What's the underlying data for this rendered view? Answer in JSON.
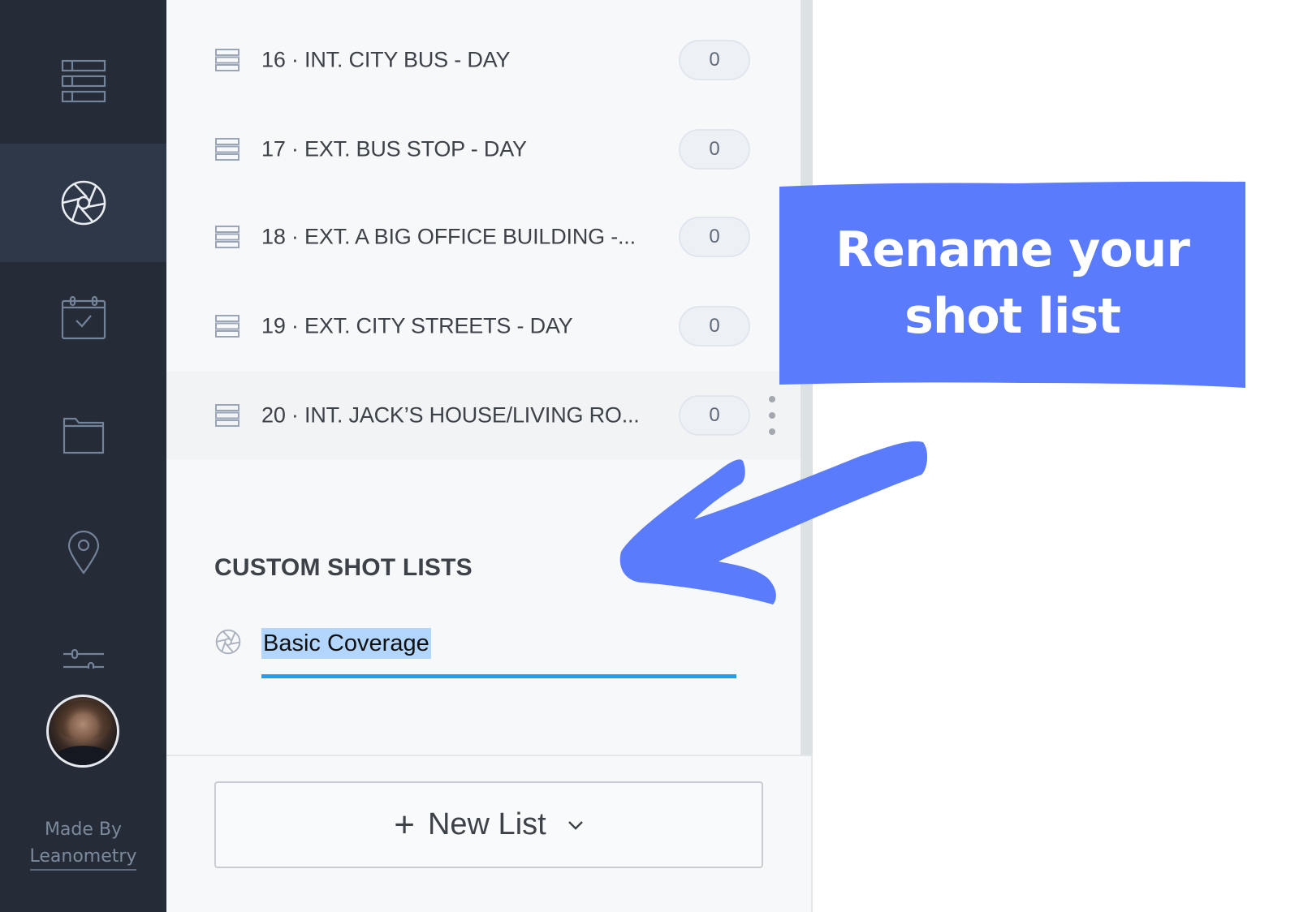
{
  "sidebar": {
    "items": [
      {
        "id": "breakdown",
        "icon": "stripboard-icon",
        "active": false
      },
      {
        "id": "shot-lists",
        "icon": "aperture-icon",
        "active": true
      },
      {
        "id": "schedule",
        "icon": "calendar-check-icon",
        "active": false
      },
      {
        "id": "files",
        "icon": "folder-icon",
        "active": false
      },
      {
        "id": "locations",
        "icon": "map-pin-icon",
        "active": false
      },
      {
        "id": "settings",
        "icon": "sliders-icon",
        "active": false
      }
    ],
    "made_by_label": "Made By",
    "made_by_link": "Leanometry"
  },
  "scenes": [
    {
      "label": "16 · INT. CITY BUS - DAY",
      "count": "0"
    },
    {
      "label": "17 · EXT. BUS STOP - DAY",
      "count": "0"
    },
    {
      "label": "18 · EXT. A BIG OFFICE BUILDING -...",
      "count": "0"
    },
    {
      "label": "19 · EXT. CITY STREETS - DAY",
      "count": "0"
    },
    {
      "label": "20 · INT. JACK’S HOUSE/LIVING RO...",
      "count": "0",
      "hovered": true
    }
  ],
  "custom_lists": {
    "title": "CUSTOM SHOT LISTS",
    "editing_name": "Basic Coverage"
  },
  "new_list_button": {
    "plus": "+",
    "label": "New List"
  },
  "annotation": {
    "line1": "Rename your",
    "line2": "shot list",
    "color": "#5b7bfd"
  },
  "colors": {
    "rail_bg": "#252b37",
    "rail_active": "#2e3849",
    "panel_bg": "#f7f8fa",
    "focus_underline": "#1ea0f2",
    "selection": "#b3d6fe"
  }
}
